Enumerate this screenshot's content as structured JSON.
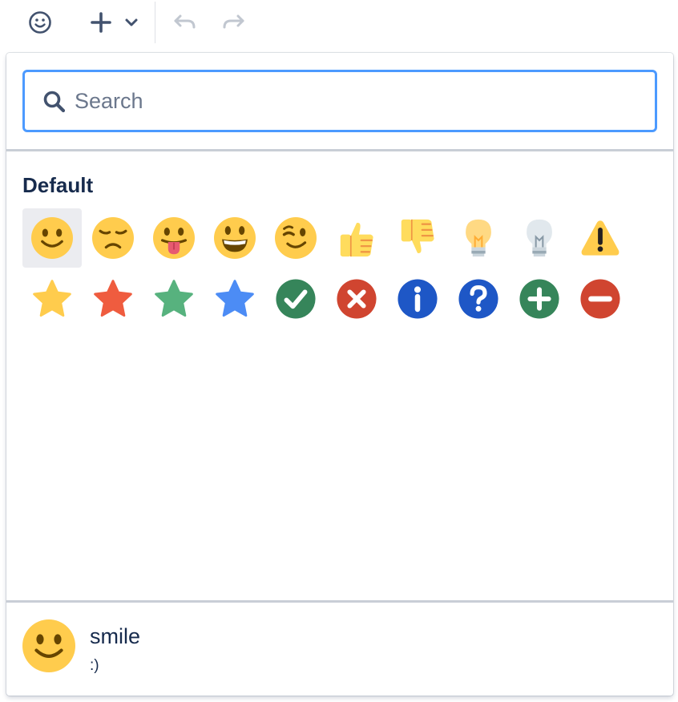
{
  "toolbar": {
    "buttons": [
      {
        "name": "emoji-button",
        "icon": "smiley-outline-icon"
      },
      {
        "name": "insert-button",
        "icon": "plus-icon",
        "has_dropdown": true
      },
      {
        "name": "undo-button",
        "icon": "undo-icon",
        "enabled": false
      },
      {
        "name": "redo-button",
        "icon": "redo-icon",
        "enabled": false
      }
    ]
  },
  "picker": {
    "search": {
      "placeholder": "Search",
      "value": ""
    },
    "category": "Default",
    "emojis": [
      {
        "id": "smile",
        "icon": "smile-emoji-icon",
        "selected": true
      },
      {
        "id": "disappointed",
        "icon": "disappointed-emoji-icon"
      },
      {
        "id": "stuck-out-tongue",
        "icon": "tongue-emoji-icon"
      },
      {
        "id": "grinning",
        "icon": "grinning-emoji-icon"
      },
      {
        "id": "wink",
        "icon": "wink-emoji-icon"
      },
      {
        "id": "thumbsup",
        "icon": "thumbs-up-emoji-icon"
      },
      {
        "id": "thumbsdown",
        "icon": "thumbs-down-emoji-icon"
      },
      {
        "id": "light-bulb-on",
        "icon": "light-bulb-on-emoji-icon"
      },
      {
        "id": "light-bulb-off",
        "icon": "light-bulb-off-emoji-icon"
      },
      {
        "id": "warning",
        "icon": "warning-emoji-icon"
      },
      {
        "id": "yellow-star",
        "icon": "yellow-star-emoji-icon"
      },
      {
        "id": "red-star",
        "icon": "red-star-emoji-icon"
      },
      {
        "id": "green-star",
        "icon": "green-star-emoji-icon"
      },
      {
        "id": "blue-star",
        "icon": "blue-star-emoji-icon"
      },
      {
        "id": "check",
        "icon": "check-mark-emoji-icon"
      },
      {
        "id": "cross",
        "icon": "cross-mark-emoji-icon"
      },
      {
        "id": "info",
        "icon": "info-emoji-icon"
      },
      {
        "id": "question",
        "icon": "question-emoji-icon"
      },
      {
        "id": "plus",
        "icon": "plus-emoji-icon"
      },
      {
        "id": "minus",
        "icon": "minus-emoji-icon"
      }
    ],
    "preview": {
      "icon": "smile-emoji-icon",
      "name": "smile",
      "shortcut": ":)"
    }
  },
  "colors": {
    "focus_border": "#4c9aff",
    "text": "#172b4d",
    "placeholder": "#6b778c",
    "divider": "#c9ced6",
    "selected_bg": "#ebecf0",
    "emoji_yellow": "#ffcc4d",
    "check_green": "#36855a",
    "cross_red": "#d04530",
    "info_blue": "#1e57c6",
    "star_red": "#ef5c3f",
    "star_green": "#57b27e",
    "star_blue": "#4c8cf5"
  }
}
